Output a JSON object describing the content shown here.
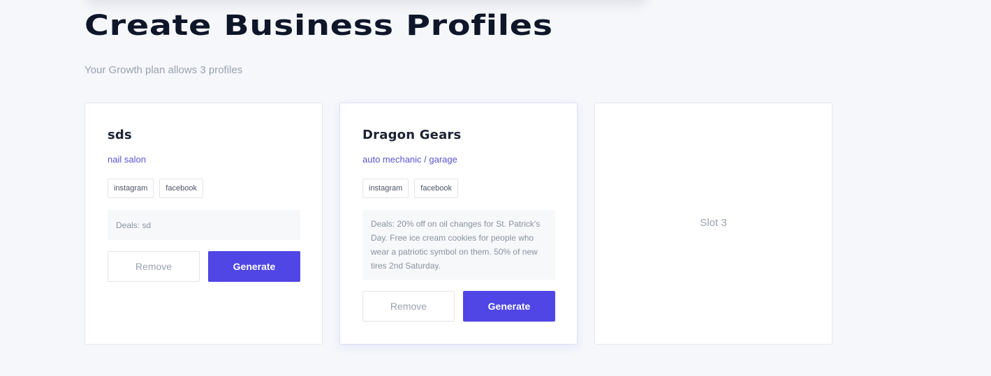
{
  "header": {
    "title": "Create Business Profiles",
    "subtitle": "Your Growth plan allows 3 profiles"
  },
  "profiles": [
    {
      "name": "sds",
      "category": "nail salon",
      "tags": [
        "instagram",
        "facebook"
      ],
      "deals": "Deals: sd",
      "remove_label": "Remove",
      "generate_label": "Generate"
    },
    {
      "name": "Dragon Gears",
      "category": "auto mechanic / garage",
      "tags": [
        "instagram",
        "facebook"
      ],
      "deals": "Deals: 20% off on oil changes for St. Patrick's Day. Free ice cream cookies for people who wear a patriotic symbol on them. 50% of new tires 2nd Saturday.",
      "remove_label": "Remove",
      "generate_label": "Generate"
    }
  ],
  "empty_slot": {
    "label": "Slot 3"
  },
  "colors": {
    "accent": "#4f46e5",
    "category_text": "#5b54d6",
    "background": "#f5f7fb"
  }
}
